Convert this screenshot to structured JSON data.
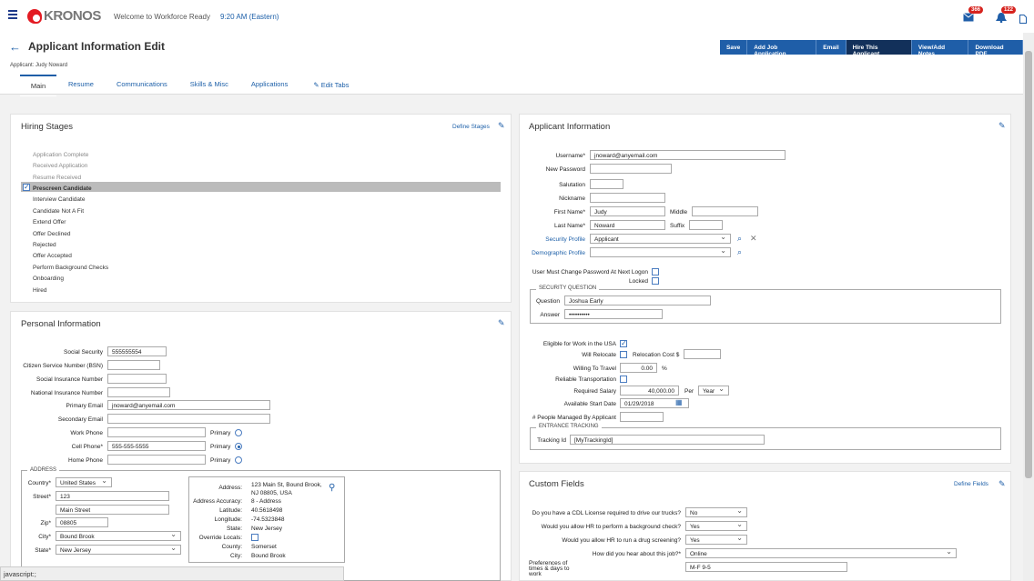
{
  "topbar": {
    "logo": "KRONOS",
    "welcome": "Welcome to Workforce Ready",
    "time": "9:20 AM (Eastern)",
    "mail_count": "366",
    "alert_count": "122"
  },
  "header": {
    "title": "Applicant Information Edit",
    "applicant": "Applicant: Judy Noward",
    "actions": [
      "Save",
      "Add Job Application",
      "Email",
      "Hire This Applicant",
      "View/Add Notes",
      "Download PDF"
    ],
    "tabs": [
      "Main",
      "Resume",
      "Communications",
      "Skills & Misc",
      "Applications"
    ],
    "edit_tabs": "Edit Tabs"
  },
  "hiring": {
    "title": "Hiring Stages",
    "define": "Define Stages",
    "stages": [
      "Application Complete",
      "Received Application",
      "Resume Received",
      "Prescreen Candidate",
      "Interview Candidate",
      "Candidate Not A Fit",
      "Extend Offer",
      "Offer Declined",
      "Rejected",
      "Offer Accepted",
      "Perform Background Checks",
      "Onboarding",
      "Hired"
    ]
  },
  "personal": {
    "title": "Personal Information",
    "labels": {
      "ssn": "Social Security",
      "bsn": "Citizen Service Number (BSN)",
      "sin": "Social Insurance Number",
      "nin": "National Insurance Number",
      "pemail": "Primary Email",
      "semail": "Secondary Email",
      "work": "Work Phone",
      "cell": "Cell Phone*",
      "home": "Home Phone",
      "primary": "Primary"
    },
    "values": {
      "ssn": "555555554",
      "pemail": "jnoward@anyemail.com",
      "cell": "555-555-5555"
    },
    "address": {
      "legend": "ADDRESS",
      "country_l": "Country*",
      "country": "United States",
      "street_l": "Street*",
      "street1": "123",
      "street2": "Main Street",
      "zip_l": "Zip*",
      "zip": "08805",
      "city_l": "City*",
      "city": "Bound Brook",
      "state_l": "State*",
      "state": "New Jersey"
    },
    "geo": {
      "address_l": "Address:",
      "address": "123 Main St, Bound Brook, NJ 08805, USA",
      "accuracy_l": "Address Accuracy:",
      "accuracy": "8 - Address",
      "lat_l": "Latitude:",
      "lat": "40.5618498",
      "lng_l": "Longitude:",
      "lng": "-74.5323848",
      "state_l": "State:",
      "state": "New Jersey",
      "override_l": "Override Locals:",
      "county_l": "County:",
      "county": "Somerset",
      "city_l": "City:",
      "city": "Bound Brook"
    }
  },
  "applicant": {
    "title": "Applicant Information",
    "labels": {
      "username": "Username*",
      "password": "New Password",
      "salutation": "Salutation",
      "nickname": "Nickname",
      "first": "First Name*",
      "middle": "Middle",
      "last": "Last Name*",
      "suffix": "Suffix",
      "security": "Security Profile",
      "demographic": "Demographic Profile",
      "must_change": "User Must Change Password At Next Logon",
      "locked": "Locked"
    },
    "values": {
      "username": "jnoward@anyemail.com",
      "first": "Judy",
      "last": "Noward",
      "security": "Applicant"
    },
    "sq": {
      "legend": "SECURITY QUESTION",
      "q_l": "Question",
      "q": "Joshua Early",
      "a_l": "Answer",
      "a": "••••••••••"
    },
    "work": {
      "eligible": "Eligible for Work in the USA",
      "relocate": "Will Relocate",
      "reloc_cost": "Relocation Cost $",
      "travel": "Willing To Travel",
      "travel_v": "0.00",
      "pct": "%",
      "transport": "Reliable Transportation",
      "salary": "Required Salary",
      "salary_v": "40,000.00",
      "per": "Per",
      "per_v": "Year",
      "start": "Available Start Date",
      "start_v": "01/29/2018",
      "managed": "# People Managed By Applicant"
    },
    "tracking": {
      "legend": "ENTRANCE TRACKING",
      "id_l": "Tracking Id",
      "id": "[MyTrackingId]"
    }
  },
  "custom": {
    "title": "Custom Fields",
    "define": "Define Fields",
    "q1": "Do you have a CDL License required to drive our trucks?",
    "a1": "No",
    "q2": "Would you allow HR to perform a background check?",
    "a2": "Yes",
    "q3": "Would you allow HR to run a drug screening?",
    "a3": "Yes",
    "q4": "How did you hear about this job?*",
    "a4": "Online",
    "q5": "Preferences of times & days to work",
    "a5": "M-F 9-5"
  },
  "status": "javascript:;"
}
